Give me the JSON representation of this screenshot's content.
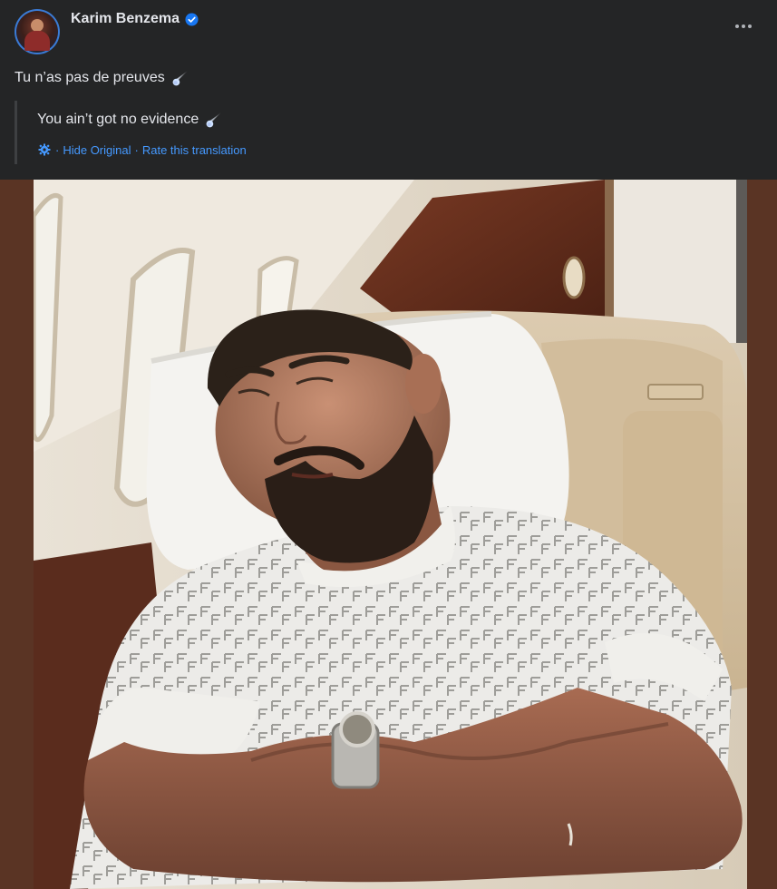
{
  "post": {
    "author": "Karim Benzema",
    "text": "Tu n’as pas de preuves",
    "translation": "You ain’t got no evidence",
    "hide_original": "Hide Original",
    "separator": "·",
    "rate_translation": "Rate this translation"
  },
  "icons": {
    "verified": "verified-badge-icon",
    "more": "more-options-icon",
    "comet": "comet-emoji-icon",
    "settings": "gear-icon"
  },
  "colors": {
    "background": "#242526",
    "text": "#e4e6eb",
    "link": "#4599ff",
    "verified": "#1877f2",
    "photo_border": "#5a3424"
  }
}
